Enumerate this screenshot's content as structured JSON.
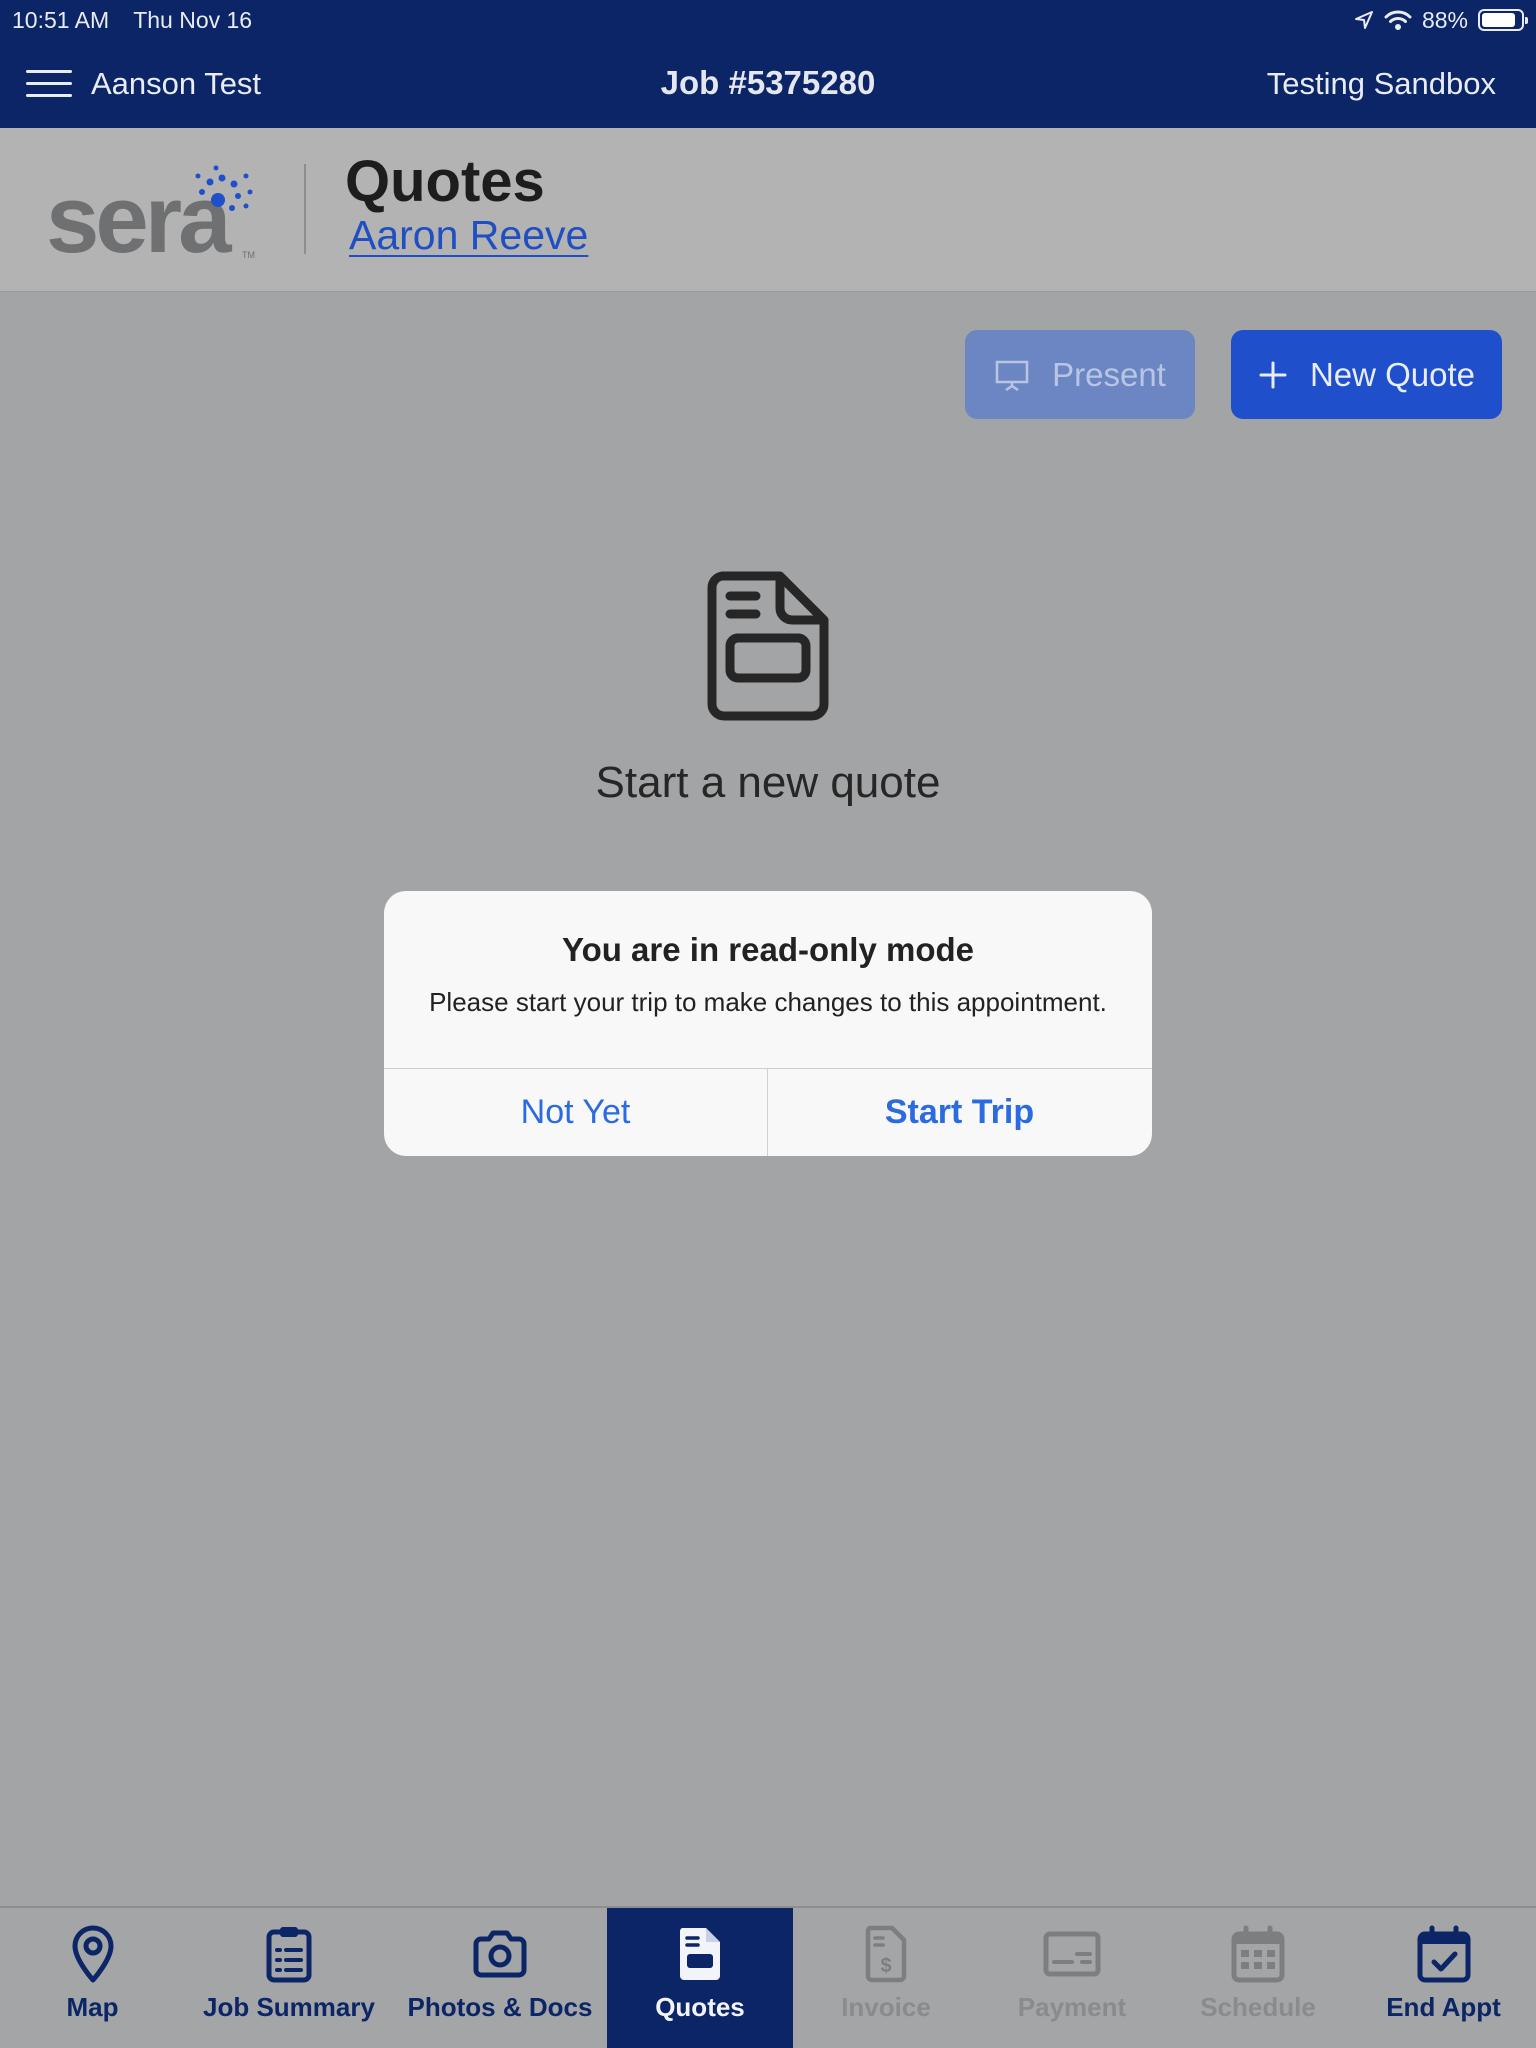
{
  "status_bar": {
    "time": "10:51 AM",
    "date": "Thu Nov 16",
    "battery": "88%",
    "battery_level": 0.88
  },
  "nav": {
    "user": "Aanson Test",
    "job": "Job #5375280",
    "environment": "Testing Sandbox"
  },
  "header": {
    "logo_text": "sera",
    "logo_tm": "TM",
    "title": "Quotes",
    "customer": "Aaron Reeve"
  },
  "actions": {
    "present_label": "Present",
    "new_quote_label": "New Quote"
  },
  "empty_state": {
    "message": "Start a new quote"
  },
  "dialog": {
    "title": "You are in read-only mode",
    "message": "Please start your trip to make changes to this appointment.",
    "cancel_label": "Not Yet",
    "confirm_label": "Start Trip"
  },
  "tabs": [
    {
      "label": "Map",
      "icon": "map-pin-icon",
      "state": "enabled"
    },
    {
      "label": "Job Summary",
      "icon": "clipboard-list-icon",
      "state": "enabled"
    },
    {
      "label": "Photos & Docs",
      "icon": "camera-icon",
      "state": "enabled"
    },
    {
      "label": "Quotes",
      "icon": "quote-document-icon",
      "state": "active"
    },
    {
      "label": "Invoice",
      "icon": "invoice-dollar-icon",
      "state": "disabled"
    },
    {
      "label": "Payment",
      "icon": "payment-card-icon",
      "state": "disabled"
    },
    {
      "label": "Schedule",
      "icon": "calendar-grid-icon",
      "state": "disabled"
    },
    {
      "label": "End Appt",
      "icon": "calendar-check-icon",
      "state": "enabled"
    }
  ],
  "colors": {
    "navy": "#0b2566",
    "brand_blue": "#1f4fcb",
    "link_blue": "#2a6be0",
    "disabled_gray": "#8a8b8c"
  }
}
